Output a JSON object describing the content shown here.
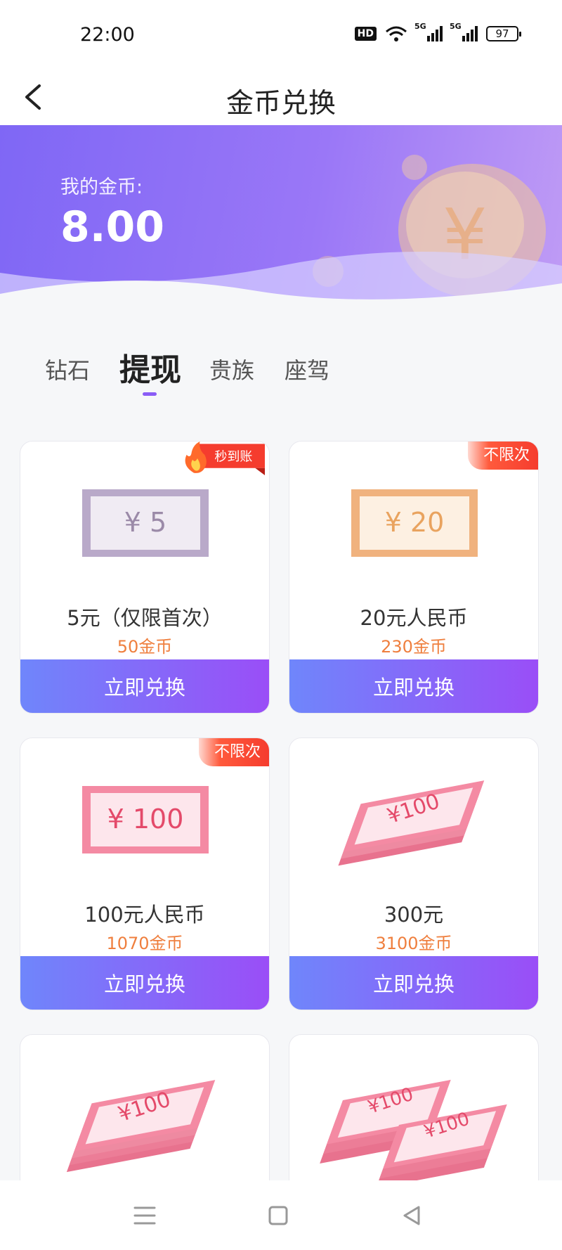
{
  "status_bar": {
    "time": "22:00",
    "hd_label": "HD",
    "signal1_label": "5G",
    "signal2_label": "5G",
    "battery": "97"
  },
  "nav": {
    "title": "金币兑换"
  },
  "banner": {
    "coin_label": "我的金币:",
    "coin_value": "8.00"
  },
  "tabs": [
    {
      "label": "钻石",
      "active": false
    },
    {
      "label": "提现",
      "active": true
    },
    {
      "label": "贵族",
      "active": false
    },
    {
      "label": "座驾",
      "active": false
    }
  ],
  "cards": [
    {
      "note_text": "¥ 5",
      "name": "5元（仅限首次）",
      "price": "50金币",
      "button": "立即兑换",
      "badge": "秒到账"
    },
    {
      "note_text": "¥ 20",
      "name": "20元人民币",
      "price": "230金币",
      "button": "立即兑换",
      "badge": "不限次"
    },
    {
      "note_text": "¥ 100",
      "name": "100元人民币",
      "price": "1070金币",
      "button": "立即兑换",
      "badge": "不限次"
    },
    {
      "note_text": "¥100",
      "name": "300元",
      "price": "3100金币",
      "button": "立即兑换"
    },
    {
      "note_text": "¥100"
    },
    {
      "note_text": "¥100",
      "note_text_b": "¥100"
    }
  ],
  "colors": {
    "accent": "#8a5cf6",
    "price": "#ef7f3e",
    "button_start": "#6f86fb",
    "button_end": "#9a4ef7",
    "badge": "#f53c2e"
  }
}
